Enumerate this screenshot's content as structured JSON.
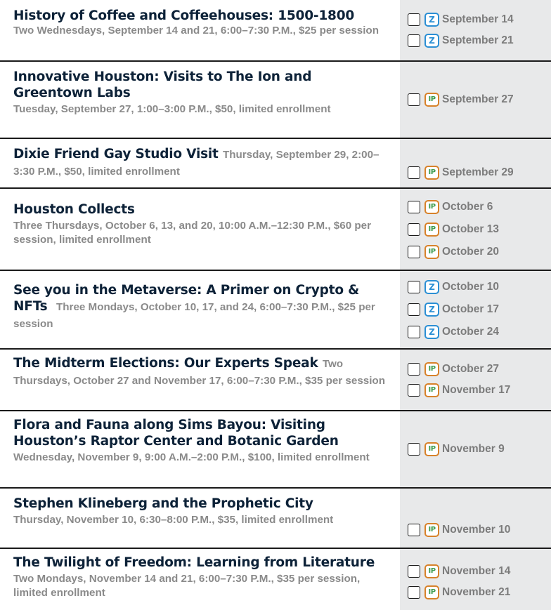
{
  "rows": [
    {
      "title": "History of Coffee and Coffeehouses: 1500-1800",
      "desc": "Two Wednesdays, September 14 and 21, 6:00–7:30 P.M., $25 per session",
      "options": [
        {
          "badge": "Z",
          "type": "zoom",
          "date": "September 14"
        },
        {
          "badge": "Z",
          "type": "zoom",
          "date": "September 21"
        }
      ]
    },
    {
      "title": "Innovative Houston: Visits to The Ion and Greentown Labs",
      "desc": "Tuesday, September 27, 1:00–3:00 P.M., $50, limited enrollment",
      "options": [
        {
          "badge": "IP",
          "type": "in-person",
          "date": "September 27"
        }
      ]
    },
    {
      "title": "Dixie Friend Gay Studio Visit",
      "desc": "Thursday, September 29, 2:00–3:30 P.M., $50, limited enrollment",
      "options": [
        {
          "badge": "IP",
          "type": "in-person",
          "date": "September 29"
        }
      ]
    },
    {
      "title": "Houston Collects",
      "desc": "Three Thursdays, October 6, 13, and 20, 10:00 A.M.–12:30 P.M., $60 per session, limited enrollment",
      "options": [
        {
          "badge": "IP",
          "type": "in-person",
          "date": "October 6"
        },
        {
          "badge": "IP",
          "type": "in-person",
          "date": "October 13"
        },
        {
          "badge": "IP",
          "type": "in-person",
          "date": "October 20"
        }
      ]
    },
    {
      "title": "See you in the Metaverse: A Primer on Crypto & NFTs",
      "desc": "Three Mondays, October 10, 17, and 24, 6:00–7:30 P.M., $25 per session",
      "options": [
        {
          "badge": "Z",
          "type": "zoom",
          "date": "October 10"
        },
        {
          "badge": "Z",
          "type": "zoom",
          "date": "October 17"
        },
        {
          "badge": "Z",
          "type": "zoom",
          "date": "October 24"
        }
      ]
    },
    {
      "title": "The Midterm Elections: Our Experts Speak",
      "desc": "Two Thursdays, October 27 and November 17, 6:00–7:30 P.M., $35 per session",
      "options": [
        {
          "badge": "IP",
          "type": "in-person",
          "date": "October 27"
        },
        {
          "badge": "IP",
          "type": "in-person",
          "date": "November 17"
        }
      ]
    },
    {
      "title": "Flora and Fauna along Sims Bayou: Visiting Houston’s Raptor Center and Botanic Garden",
      "desc": "Wednesday, November 9, 9:00 A.M.–2:00 P.M., $100, limited enrollment",
      "options": [
        {
          "badge": "IP",
          "type": "in-person",
          "date": "November 9"
        }
      ]
    },
    {
      "title": "Stephen Klineberg and the Prophetic City",
      "desc": "Thursday, November 10, 6:30–8:00 P.M., $35, limited enrollment",
      "options": [
        {
          "badge": "IP",
          "type": "in-person",
          "date": "November 10"
        }
      ]
    },
    {
      "title": "The Twilight of Freedom: Learning from Literature",
      "desc": "Two Mondays, November 14 and 21, 6:00–7:30 P.M., $35 per session, limited enrollment",
      "options": [
        {
          "badge": "IP",
          "type": "in-person",
          "date": "November 14"
        },
        {
          "badge": "IP",
          "type": "in-person",
          "date": "November 21"
        }
      ]
    }
  ]
}
